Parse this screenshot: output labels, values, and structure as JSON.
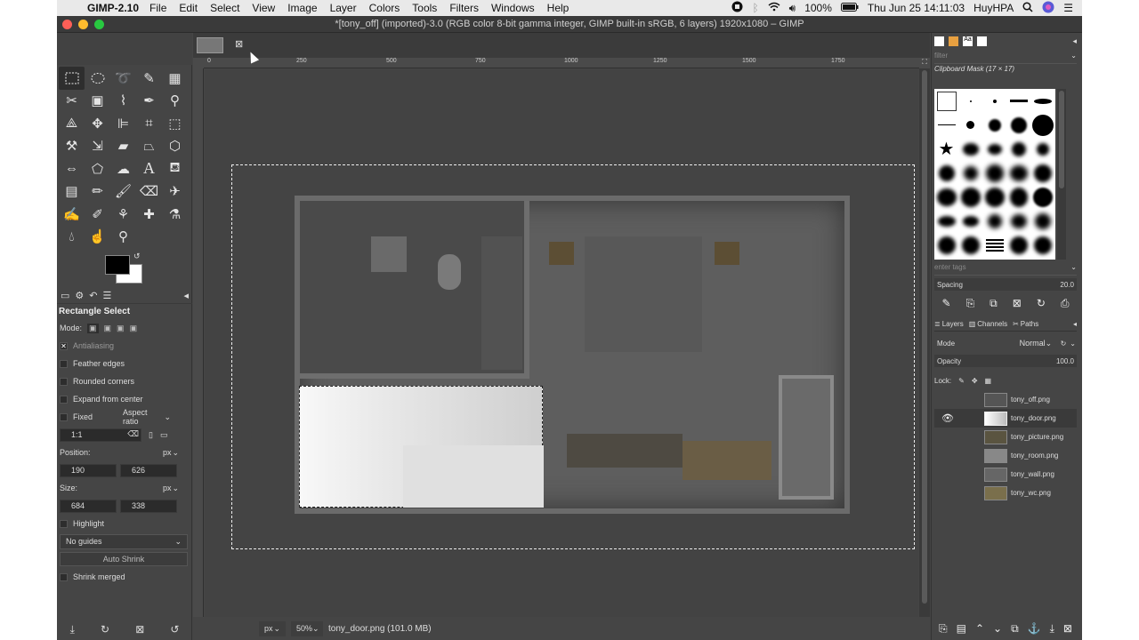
{
  "menubar": {
    "apple_icon": "apple-icon",
    "app_name": "GIMP-2.10",
    "items": [
      "File",
      "Edit",
      "Select",
      "View",
      "Image",
      "Layer",
      "Colors",
      "Tools",
      "Filters",
      "Windows",
      "Help"
    ],
    "battery": "100%",
    "datetime": "Thu Jun 25  14:11:03",
    "user": "HuyHPA"
  },
  "window": {
    "title": "*[tony_off] (imported)-3.0 (RGB color 8-bit gamma integer, GIMP built-in sRGB, 6 layers) 1920x1080 – GIMP"
  },
  "tool_options": {
    "tool_name": "Rectangle Select",
    "mode_label": "Mode:",
    "antialiasing": "Antialiasing",
    "feather_edges": "Feather edges",
    "rounded_corners": "Rounded corners",
    "expand_from_center": "Expand from center",
    "fixed": "Fixed",
    "aspect_ratio": "Aspect ratio",
    "ratio_value": "1:1",
    "position_label": "Position:",
    "position_unit": "px",
    "position_x": "190",
    "position_y": "626",
    "size_label": "Size:",
    "size_unit": "px",
    "size_w": "684",
    "size_h": "338",
    "highlight": "Highlight",
    "guides": "No guides",
    "auto_shrink": "Auto Shrink",
    "shrink_merged": "Shrink merged"
  },
  "ruler": {
    "labels": [
      "0",
      "250",
      "500",
      "750",
      "1000",
      "1250",
      "1500",
      "1750"
    ]
  },
  "statusbar": {
    "unit": "px",
    "zoom": "50%",
    "layer_info": "tony_door.png (101.0 MB)"
  },
  "brushes": {
    "filter_placeholder": "filter",
    "current_brush": "Clipboard Mask (17 × 17)",
    "tags_placeholder": "enter tags",
    "spacing_label": "Spacing",
    "spacing_value": "20.0"
  },
  "layers": {
    "tabs": [
      "Layers",
      "Channels",
      "Paths"
    ],
    "mode_label": "Mode",
    "mode_value": "Normal",
    "opacity_label": "Opacity",
    "opacity_value": "100.0",
    "lock_label": "Lock:",
    "items": [
      {
        "name": "tony_off.png",
        "visible": false
      },
      {
        "name": "tony_door.png",
        "visible": true
      },
      {
        "name": "tony_picture.png",
        "visible": false
      },
      {
        "name": "tony_room.png",
        "visible": false
      },
      {
        "name": "tony_wall.png",
        "visible": false
      },
      {
        "name": "tony_wc.png",
        "visible": false
      }
    ]
  }
}
